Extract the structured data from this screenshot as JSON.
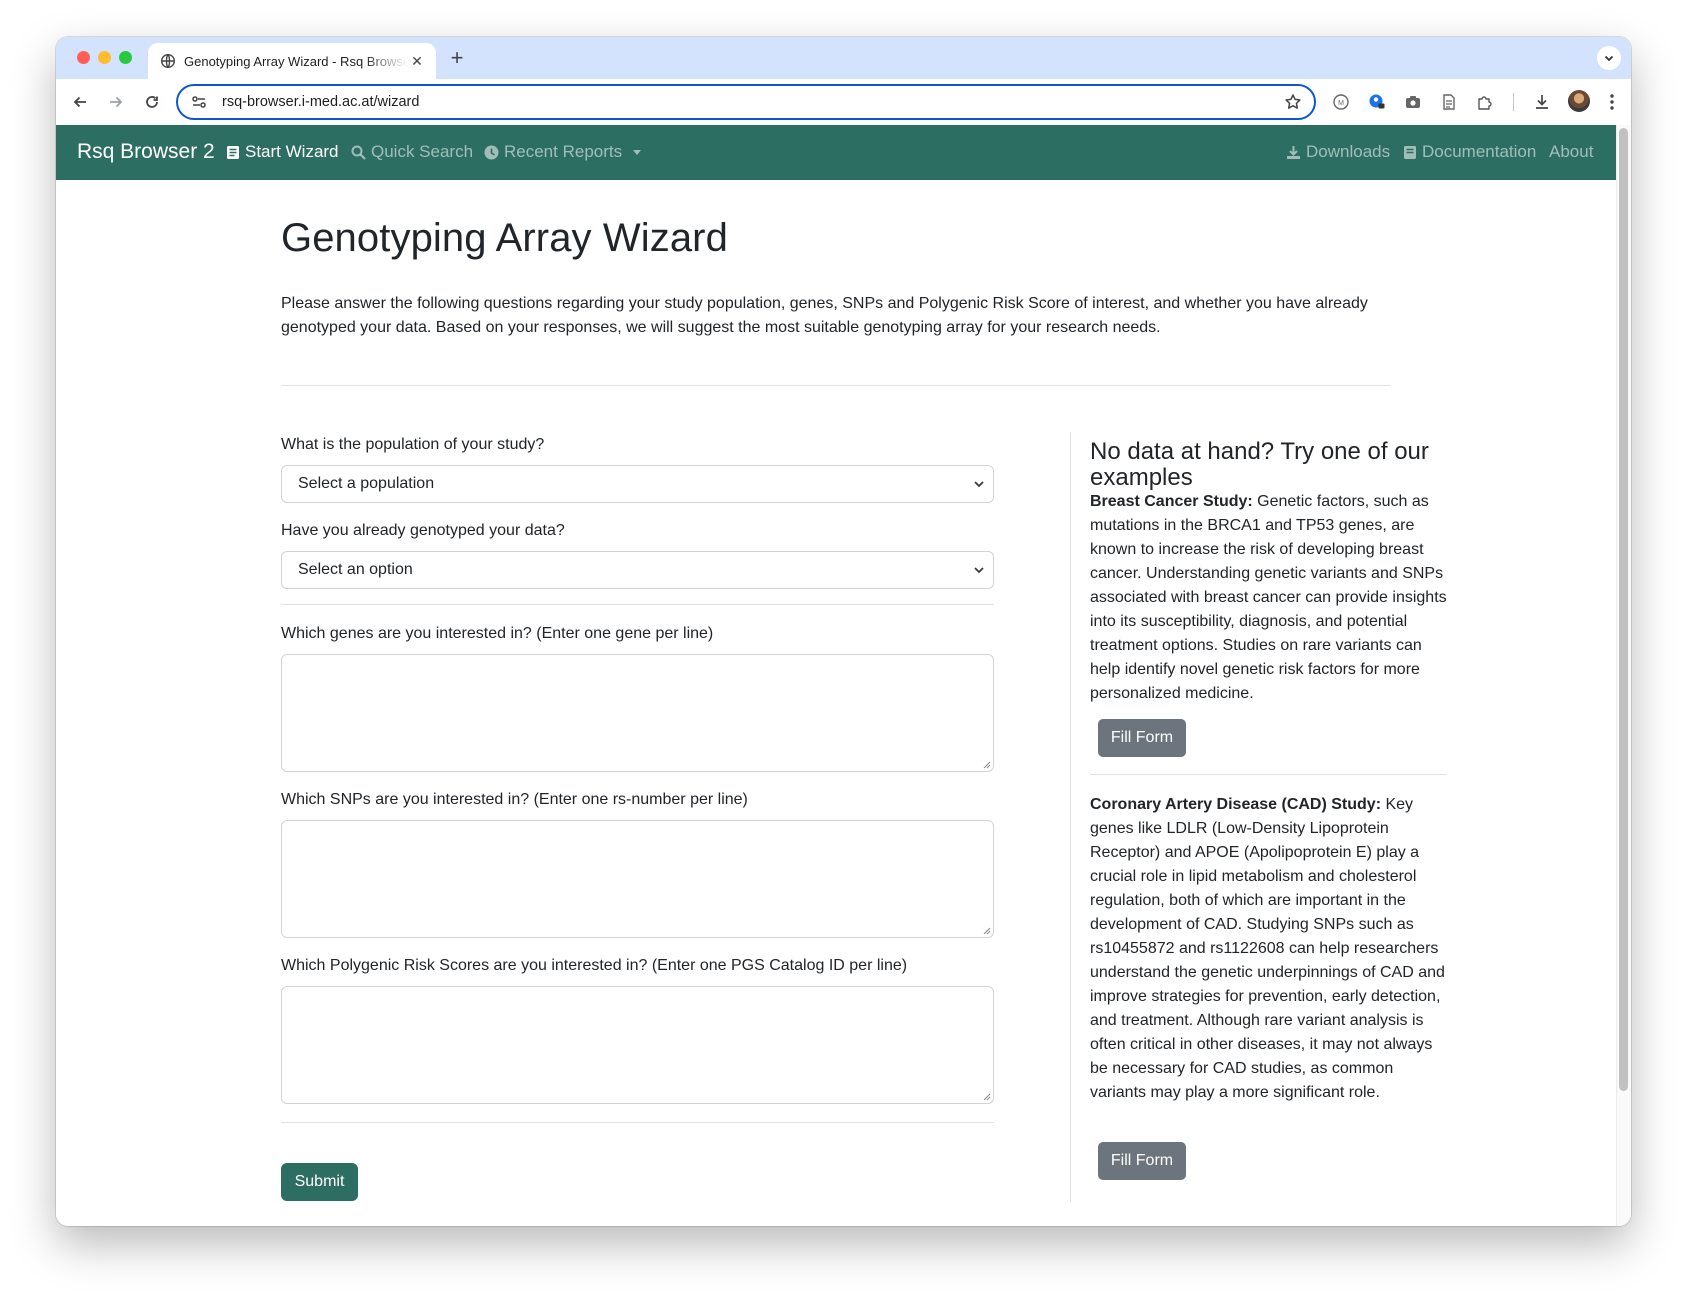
{
  "browser": {
    "tab_title": "Genotyping Array Wizard - Rsq Browser 2",
    "url": "rsq-browser.i-med.ac.at/wizard",
    "new_tab_label": "+"
  },
  "navbar": {
    "brand": "Rsq Browser 2",
    "left_links": [
      "Start Wizard",
      "Quick Search",
      "Recent Reports"
    ],
    "right_links": [
      "Downloads",
      "Documentation",
      "About"
    ],
    "bg_color": "#2d6e62"
  },
  "page": {
    "title": "Genotyping Array Wizard",
    "intro": "Please answer the following questions regarding your study population, genes, SNPs and Polygenic Risk Score of interest, and whether you have already genotyped your data. Based on your responses, we will suggest the most suitable genotyping array for your research needs."
  },
  "form": {
    "population_label": "What is the population of your study?",
    "population_selected": "Select a population",
    "genotyped_label": "Have you already genotyped your data?",
    "genotyped_selected": "Select an option",
    "genes_label": "Which genes are you interested in? (Enter one gene per line)",
    "snps_label": "Which SNPs are you interested in? (Enter one rs-number per line)",
    "prs_label": "Which Polygenic Risk Scores are you interested in? (Enter one PGS Catalog ID per line)",
    "submit_label": "Submit"
  },
  "examples": {
    "heading": "No data at hand? Try one of our examples",
    "items": [
      {
        "title": "Breast Cancer Study:",
        "text": " Genetic factors, such as mutations in the BRCA1 and TP53 genes, are known to increase the risk of developing breast cancer. Understanding genetic variants and SNPs associated with breast cancer can provide insights into its susceptibility, diagnosis, and potential treatment options. Studies on rare variants can help identify novel genetic risk factors for more personalized medicine.",
        "button": "Fill Form"
      },
      {
        "title": "Coronary Artery Disease (CAD) Study:",
        "text": " Key genes like LDLR (Low-Density Lipoprotein Receptor) and APOE (Apolipoprotein E) play a crucial role in lipid metabolism and cholesterol regulation, both of which are important in the development of CAD. Studying SNPs such as rs10455872 and rs1122608 can help researchers understand the genetic underpinnings of CAD and improve strategies for prevention, early detection, and treatment. Although rare variant analysis is often critical in other diseases, it may not always be necessary for CAD studies, as common variants may play a more significant role.",
        "button": "Fill Form"
      }
    ]
  }
}
